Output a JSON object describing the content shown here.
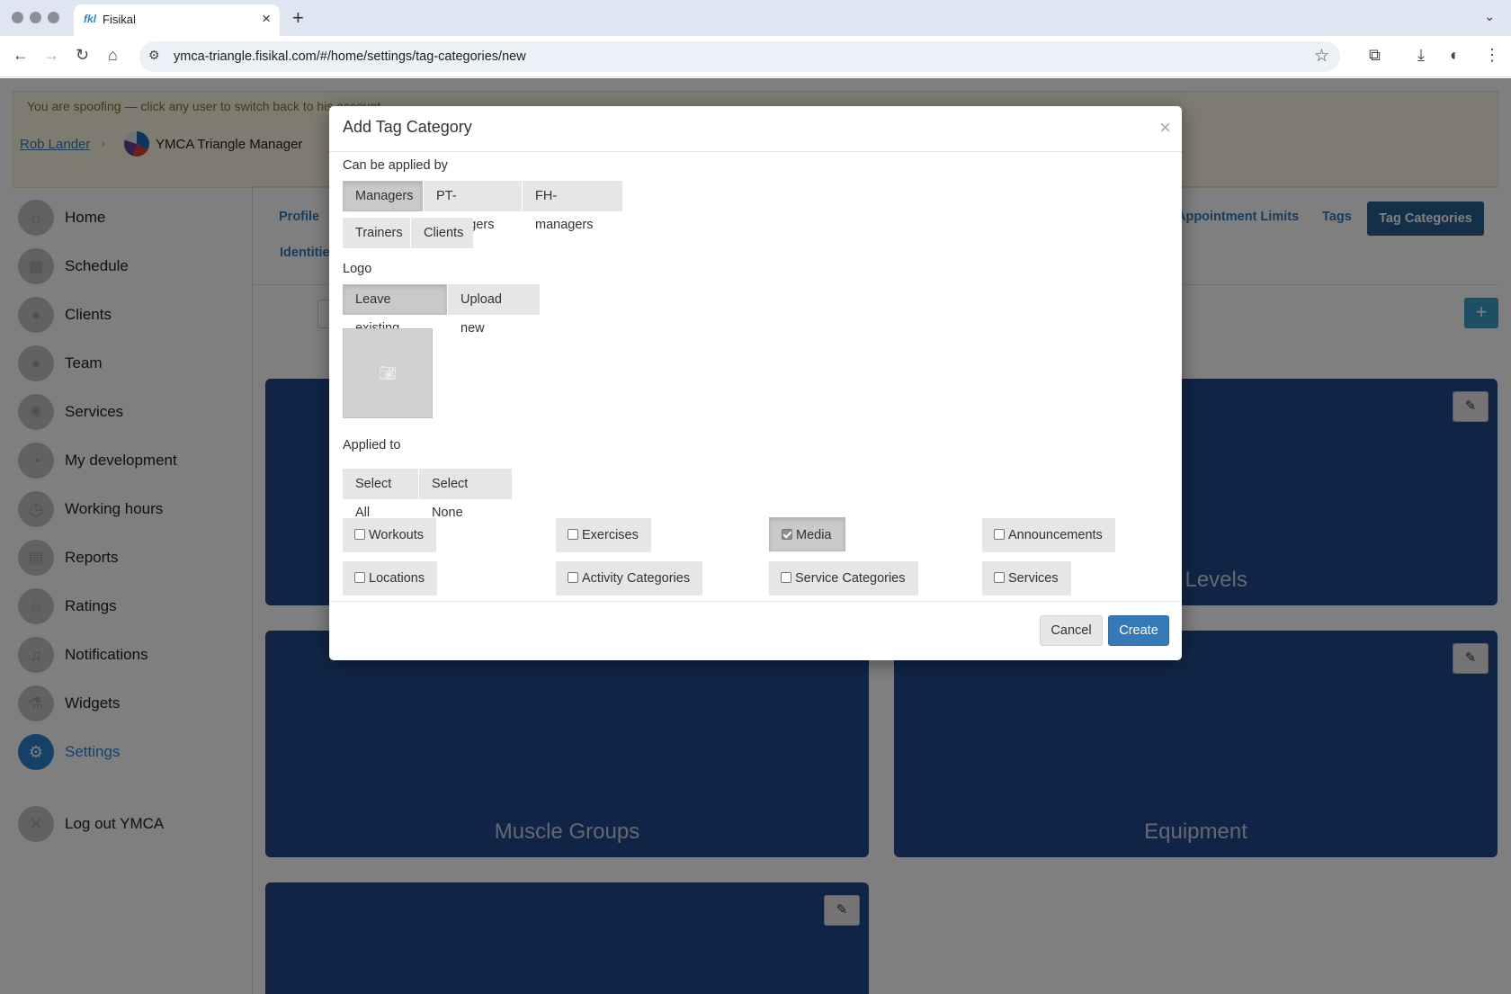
{
  "browser": {
    "tab_title": "Fisikal",
    "tab_favicon": "fkl",
    "url": "ymca-triangle.fisikal.com/#/home/settings/tag-categories/new"
  },
  "banner": {
    "spoof_text": "You are spoofing — click any user to switch back to his account",
    "crumb_user": "Rob Lander",
    "crumb_manager": "YMCA Triangle Manager"
  },
  "sidebar": {
    "items": [
      {
        "label": "Home",
        "icon": "home-icon"
      },
      {
        "label": "Schedule",
        "icon": "calendar-icon"
      },
      {
        "label": "Clients",
        "icon": "clients-icon"
      },
      {
        "label": "Team",
        "icon": "team-icon"
      },
      {
        "label": "Services",
        "icon": "services-icon"
      },
      {
        "label": "My development",
        "icon": "gauge-icon"
      },
      {
        "label": "Working hours",
        "icon": "clock-icon"
      },
      {
        "label": "Reports",
        "icon": "reports-icon"
      },
      {
        "label": "Ratings",
        "icon": "star-icon"
      },
      {
        "label": "Notifications",
        "icon": "bell-icon"
      },
      {
        "label": "Widgets",
        "icon": "flask-icon"
      },
      {
        "label": "Settings",
        "icon": "gear-icon",
        "active": true
      },
      {
        "label": "Log out YMCA",
        "icon": "close-circle-icon"
      }
    ]
  },
  "settings_nav": {
    "profile": "Profile",
    "identities": "Identitie",
    "appointment_limits": "Appointment Limits",
    "tags": "Tags",
    "tag_categories": "Tag Categories"
  },
  "cards": {
    "experience": "nce Levels",
    "muscle_groups": "Muscle Groups",
    "equipment": "Equipment"
  },
  "modal": {
    "title": "Add Tag Category",
    "close": "×",
    "applied_by_label": "Can be applied by",
    "applied_by": [
      "Managers",
      "PT-managers",
      "FH-managers",
      "Trainers",
      "Clients"
    ],
    "applied_by_selected": "Managers",
    "logo_label": "Logo",
    "logo_options": [
      "Leave existing",
      "Upload new"
    ],
    "logo_selected": "Leave existing",
    "applied_to_label": "Applied to",
    "select_all": "Select All",
    "select_none": "Select None",
    "applied_to": [
      {
        "label": "Workouts",
        "checked": false
      },
      {
        "label": "Exercises",
        "checked": false
      },
      {
        "label": "Media",
        "checked": true
      },
      {
        "label": "Announcements",
        "checked": false
      },
      {
        "label": "Locations",
        "checked": false
      },
      {
        "label": "Activity Categories",
        "checked": false
      },
      {
        "label": "Service Categories",
        "checked": false
      },
      {
        "label": "Services",
        "checked": false
      }
    ],
    "cancel": "Cancel",
    "create": "Create"
  }
}
